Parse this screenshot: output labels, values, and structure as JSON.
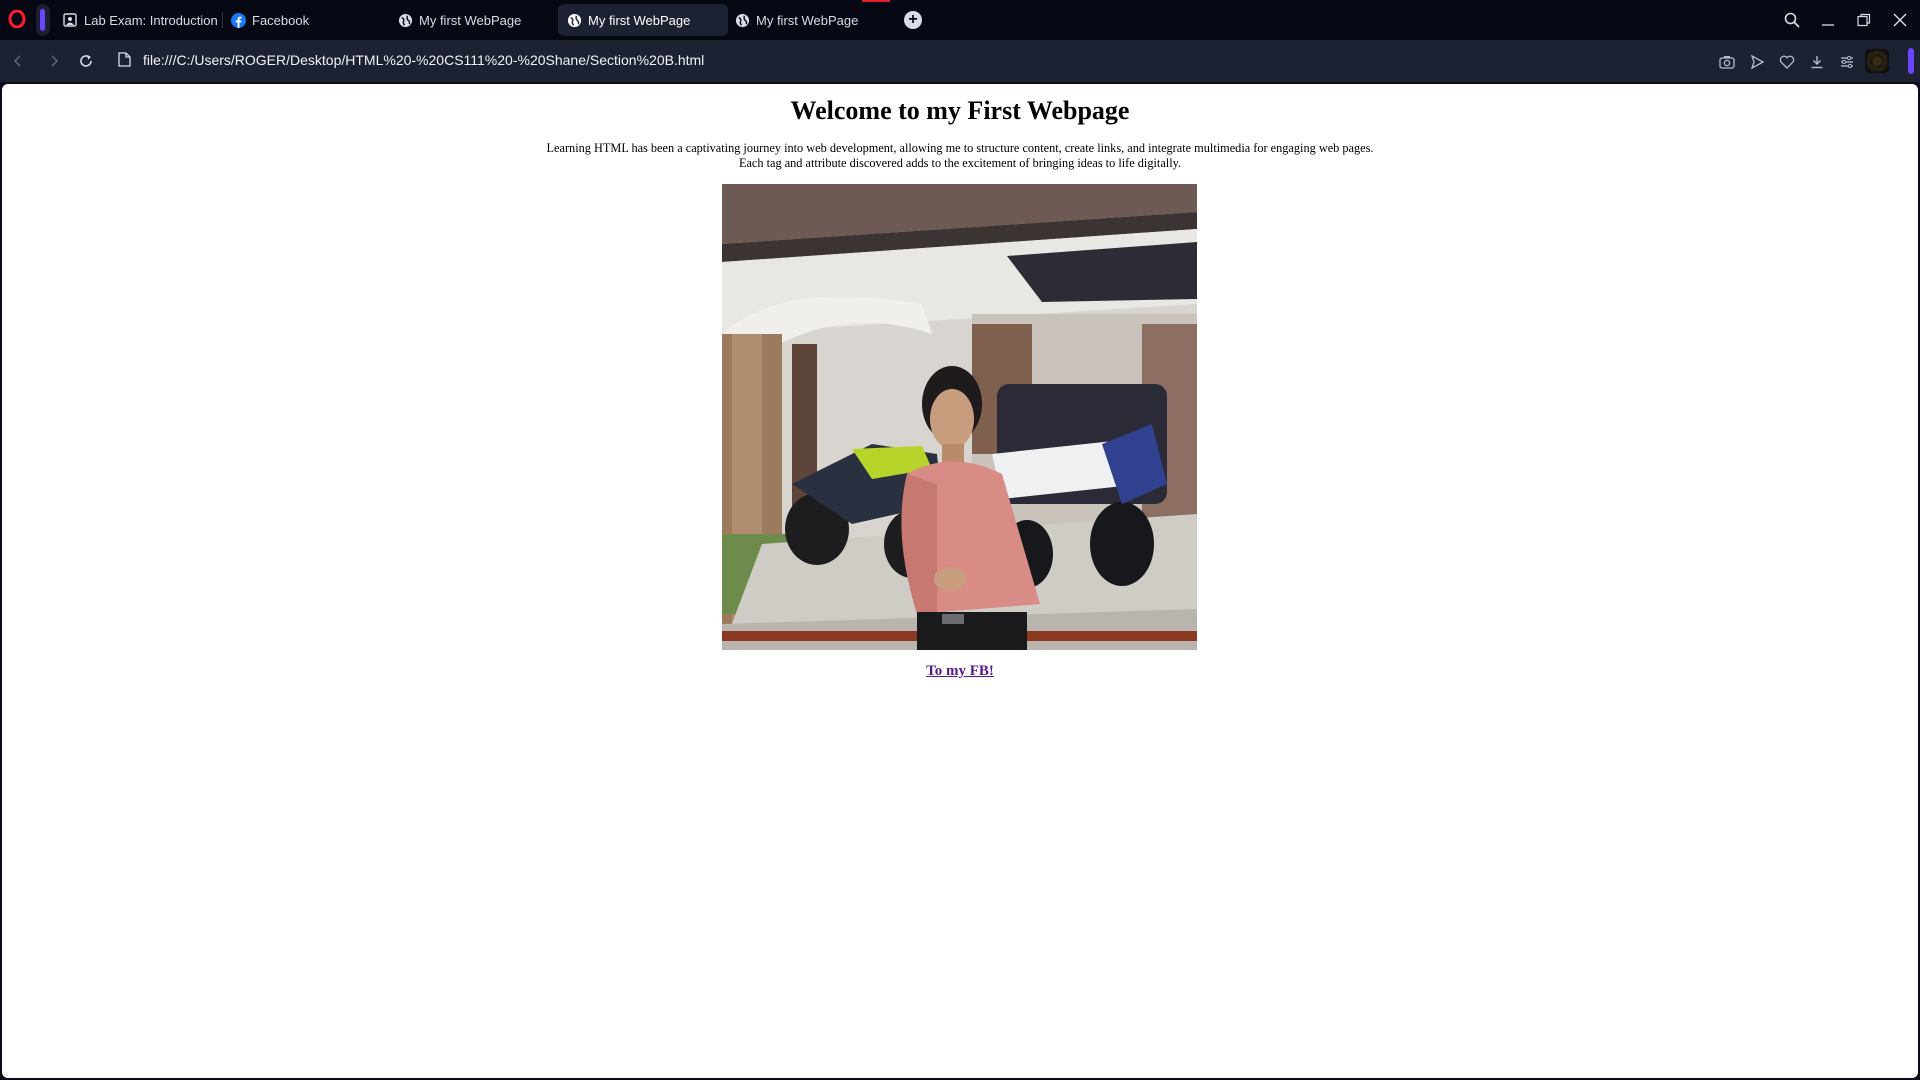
{
  "browser": {
    "tabs": [
      {
        "label": "Lab Exam: Introduction to",
        "icon": "document-image-icon"
      },
      {
        "label": "Facebook",
        "icon": "facebook-icon"
      },
      {
        "label": "My first WebPage",
        "icon": "globe-icon"
      },
      {
        "label": "My first WebPage",
        "icon": "globe-icon",
        "active": true
      },
      {
        "label": "My first WebPage",
        "icon": "globe-icon"
      }
    ],
    "address": "file:///C:/Users/ROGER/Desktop/HTML%20-%20CS111%20-%20Shane/Section%20B.html",
    "accent_color": "#6a44ff",
    "brand_color": "#e0202e"
  },
  "page": {
    "heading": "Welcome to my First Webpage",
    "paragraph_line1": "Learning HTML has been a captivating journey into web development, allowing me to structure content, create links, and integrate multimedia for engaging web pages.",
    "paragraph_line2": "Each tag and attribute discovered adds to the excitement of bringing ideas to life digitally.",
    "link_text": "To my FB!",
    "link_color": "#551a8b"
  }
}
